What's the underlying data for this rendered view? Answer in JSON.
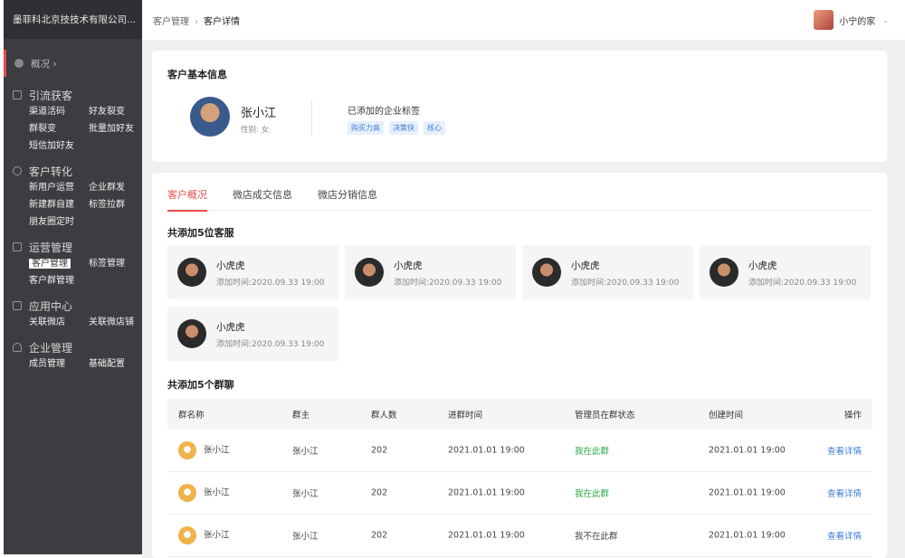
{
  "sidebar": {
    "company": "墨菲科北京技技术有限公司...",
    "overview": "概况 ›",
    "groups": [
      {
        "title": "引流获客",
        "items": [
          "渠道活码",
          "好友裂变",
          "群裂变",
          "批量加好友",
          "短信加好友"
        ]
      },
      {
        "title": "客户转化",
        "items": [
          "新用户运营",
          "企业群发",
          "新建群自建",
          "标签拉群",
          "朋友圈定时"
        ]
      },
      {
        "title": "运营管理",
        "items": [
          "客户管理",
          "标签管理",
          "客户群管理"
        ]
      },
      {
        "title": "应用中心",
        "items": [
          "关联微店",
          "关联微店铺"
        ]
      },
      {
        "title": "企业管理",
        "items": [
          "成员管理",
          "基础配置"
        ]
      }
    ]
  },
  "topbar": {
    "crumb_parent": "客户管理",
    "crumb_sep": "›",
    "crumb_current": "客户详情",
    "user_name": "小宁的家",
    "chevron": "⌄"
  },
  "basic": {
    "title": "客户基本信息",
    "name": "张小江",
    "gender": "性别: 女",
    "tag_title": "已添加的企业标签",
    "tags": [
      "购买力高",
      "决策快",
      "核心"
    ]
  },
  "tabs": [
    "客户概况",
    "微店成交信息",
    "微店分销信息"
  ],
  "services": {
    "title": "共添加5位客服",
    "items": [
      {
        "name": "小虎虎",
        "time": "添加时间:2020.09.33 19:00"
      },
      {
        "name": "小虎虎",
        "time": "添加时间:2020.09.33 19:00"
      },
      {
        "name": "小虎虎",
        "time": "添加时间:2020.09.33 19:00"
      },
      {
        "name": "小虎虎",
        "time": "添加时间:2020.09.33 19:00"
      },
      {
        "name": "小虎虎",
        "time": "添加时间:2020.09.33 19:00"
      }
    ]
  },
  "groups": {
    "title": "共添加5个群聊",
    "columns": [
      "群名称",
      "群主",
      "群人数",
      "进群时间",
      "管理员在群状态",
      "创建时间",
      "操作"
    ],
    "rows": [
      {
        "name": "张小江",
        "owner": "张小江",
        "count": "202",
        "join": "2021.01.01 19:00",
        "status": "我在此群",
        "created": "2021.01.01 19:00",
        "action": "查看详情"
      },
      {
        "name": "张小江",
        "owner": "张小江",
        "count": "202",
        "join": "2021.01.01 19:00",
        "status": "我在此群",
        "created": "2021.01.01 19:00",
        "action": "查看详情"
      },
      {
        "name": "张小江",
        "owner": "张小江",
        "count": "202",
        "join": "2021.01.01 19:00",
        "status": "我不在此群",
        "created": "2021.01.01 19:00",
        "action": "查看详情"
      }
    ]
  }
}
